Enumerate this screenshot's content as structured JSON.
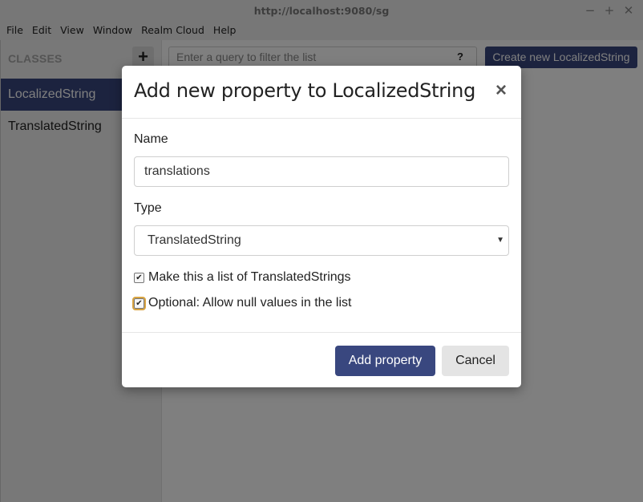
{
  "window": {
    "title": "http://localhost:9080/sg",
    "controls": {
      "minimize": "−",
      "maximize": "+",
      "close": "✕"
    }
  },
  "menubar": {
    "items": [
      "File",
      "Edit",
      "View",
      "Window",
      "Realm Cloud",
      "Help"
    ]
  },
  "sidebar": {
    "title": "CLASSES",
    "add_label": "+",
    "items": [
      {
        "label": "LocalizedString",
        "selected": true
      },
      {
        "label": "TranslatedString",
        "selected": false
      }
    ]
  },
  "toolbar": {
    "query_placeholder": "Enter a query to filter the list",
    "help_label": "?",
    "create_button": "Create new LocalizedString"
  },
  "modal": {
    "title": "Add new property to LocalizedString",
    "close_label": "×",
    "name_label": "Name",
    "name_value": "translations",
    "type_label": "Type",
    "type_value": "TranslatedString",
    "list_checkbox_label": "Make this a list of TranslatedStrings",
    "list_checked": true,
    "optional_checkbox_label": "Optional: Allow null values in the list",
    "optional_checked": true,
    "submit_label": "Add property",
    "cancel_label": "Cancel"
  },
  "colors": {
    "accent": "#39477f"
  }
}
